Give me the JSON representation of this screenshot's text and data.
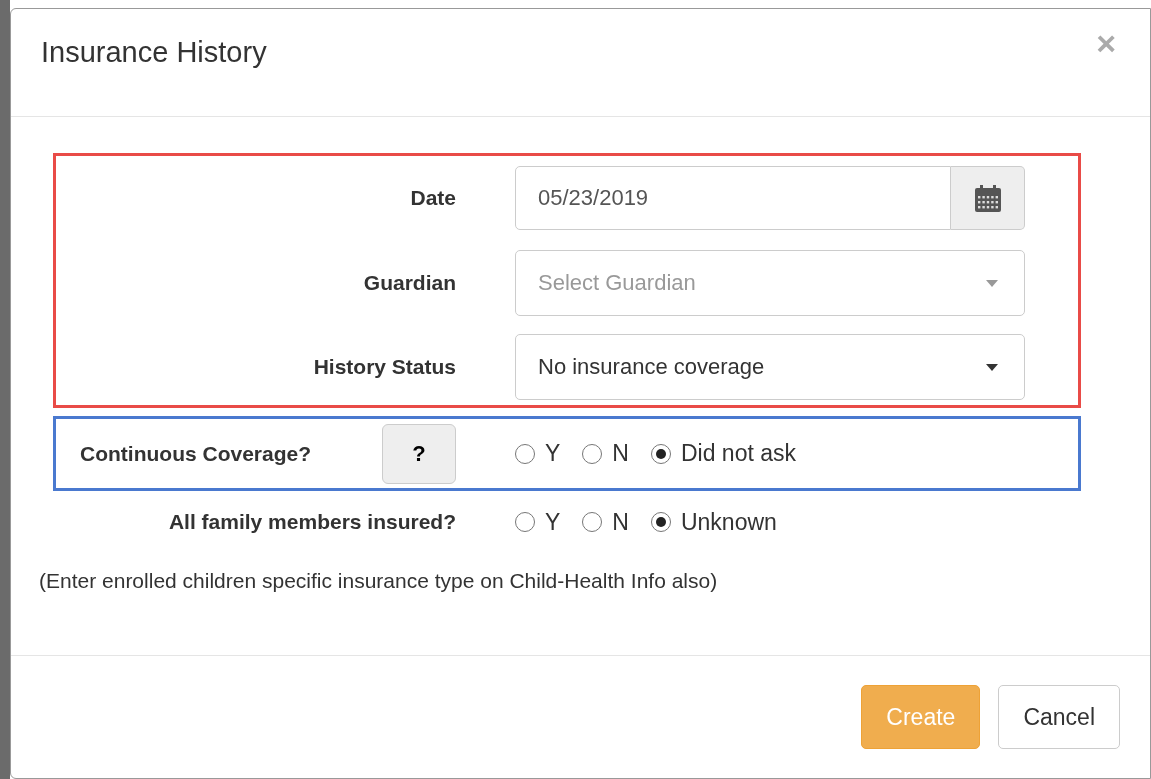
{
  "modal": {
    "title": "Insurance History",
    "close": "×"
  },
  "fields": [
    {
      "kind": "date",
      "label": "Date",
      "value": "05/23/2019"
    },
    {
      "kind": "select",
      "label": "Guardian",
      "placeholder": "Select Guardian"
    },
    {
      "kind": "select",
      "label": "History Status",
      "value": "No insurance coverage"
    }
  ],
  "continuous_coverage": {
    "label": "Continuous Coverage?",
    "help": "?",
    "options": [
      {
        "label": "Y",
        "selected": false
      },
      {
        "label": "N",
        "selected": false
      },
      {
        "label": "Did not ask",
        "selected": true
      }
    ]
  },
  "family_insured": {
    "label": "All family members insured?",
    "options": [
      {
        "label": "Y",
        "selected": false
      },
      {
        "label": "N",
        "selected": false
      },
      {
        "label": "Unknown",
        "selected": true
      }
    ]
  },
  "note": "(Enter enrolled children specific insurance type on Child-Health Info also)",
  "buttons": [
    {
      "kind": "primary",
      "label": "Create"
    },
    {
      "kind": "default",
      "label": "Cancel"
    }
  ]
}
